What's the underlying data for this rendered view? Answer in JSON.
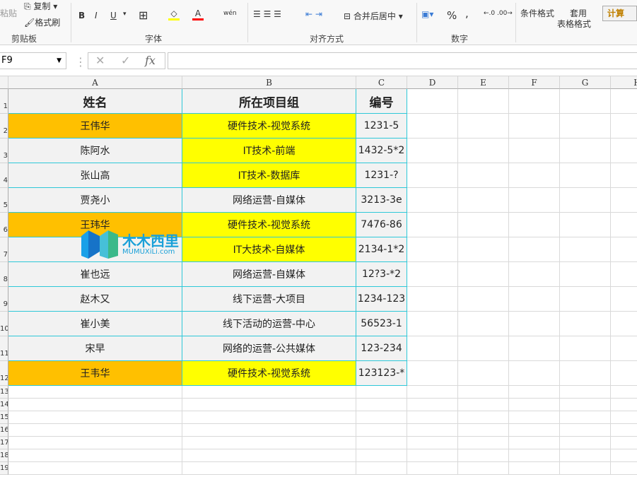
{
  "ribbon": {
    "paste": "粘贴",
    "copy": "复制",
    "format_painter": "格式刷",
    "clipboard_group": "剪贴板",
    "bold": "B",
    "italic": "I",
    "underline": "U",
    "font_group": "字体",
    "phonetic": "wén",
    "merge_center": "合并后居中",
    "align_group": "对齐方式",
    "percent": "%",
    "comma": ",",
    "number_group": "数字",
    "conditional_format": "条件格式",
    "table_format_1": "套用",
    "table_format_2": "表格格式",
    "style_calc": "计算",
    "colors": {
      "fill": "#ffff00",
      "font": "#ff0000",
      "calc_text": "#c08000"
    }
  },
  "formula_bar": {
    "name_box": "F9",
    "cancel": "✕",
    "enter": "✓",
    "fx": "fx",
    "value": ""
  },
  "columns": [
    "A",
    "B",
    "C",
    "D",
    "E",
    "F",
    "G",
    "H"
  ],
  "table": {
    "headers": [
      "姓名",
      "所在项目组",
      "编号"
    ],
    "rows": [
      {
        "name": "王伟华",
        "group": "硬件技术-视觉系统",
        "id": "1231-5",
        "hl": true
      },
      {
        "name": "陈阿水",
        "group": "IT技术-前端",
        "id": "1432-5*2",
        "hl": false,
        "yb": true
      },
      {
        "name": "张山高",
        "group": "IT技术-数据库",
        "id": "1231-?",
        "hl": false,
        "yb": true
      },
      {
        "name": "贾尧小",
        "group": "网络运营-自媒体",
        "id": "3213-3e",
        "hl": false,
        "yb": false
      },
      {
        "name": "王玮华",
        "group": "硬件技术-视觉系统",
        "id": "7476-86",
        "hl": true
      },
      {
        "name": "",
        "group": "IT大技术-自媒体",
        "id": "2134-1*2",
        "hl": false,
        "yb": true
      },
      {
        "name": "崔也远",
        "group": "网络运营-自媒体",
        "id": "12?3-*2",
        "hl": false,
        "yb": false
      },
      {
        "name": "赵木又",
        "group": "线下运营-大项目",
        "id": "1234-123",
        "hl": false,
        "yb": false
      },
      {
        "name": "崔小美",
        "group": "线下活动的运营-中心",
        "id": "56523-1",
        "hl": false,
        "yb": false
      },
      {
        "name": "宋早",
        "group": "网络的运营-公共媒体",
        "id": "123-234",
        "hl": false,
        "yb": false
      },
      {
        "name": "王韦华",
        "group": "硬件技术-视觉系统",
        "id": "123123-*",
        "hl": true
      }
    ],
    "colors": {
      "orange": "#ffc000",
      "yellow": "#ffff00",
      "gray": "#f2f2f2",
      "border": "#2ec8d8"
    }
  },
  "row_numbers": [
    "1",
    "2",
    "3",
    "4",
    "5",
    "6",
    "7",
    "8",
    "9",
    "10",
    "11",
    "12",
    "13",
    "14",
    "15",
    "16",
    "17",
    "18",
    "19"
  ],
  "watermark": {
    "title": "木木西里",
    "sub": "MUMUXiLi.com"
  }
}
